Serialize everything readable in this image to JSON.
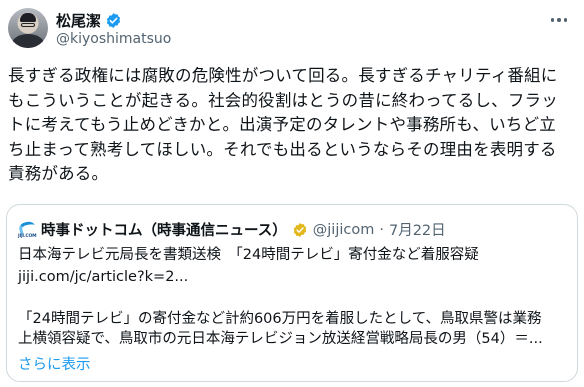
{
  "author": {
    "display_name": "松尾潔",
    "handle": "@kiyoshimatsuo",
    "verified_color": "#1d9bf0"
  },
  "tweet": {
    "text": "長すぎる政権には腐敗の危険性がついて回る。長すぎるチャリティ番組に\nもこういうことが起きる。社会的役割はとうの昔に終わってるし、フラッ\nトに考えてもう止めどきかと。出演予定のタレントや事務所も、いちど立\nち止まって熟考してほしい。それでも出るというならその理由を表明する\n責務がある。"
  },
  "quote": {
    "logo_label": "JIJI.COM",
    "name": "時事ドットコム（時事通信ニュース）",
    "verified_color": "#e2b719",
    "handle": "@jijicom",
    "separator": "·",
    "date": "7月22日",
    "headline": "日本海テレビ元局長を書類送検　「24時間テレビ」寄付金など着服容疑",
    "url": "jiji.com/jc/article?k=2...",
    "body": "「24時間テレビ」の寄付金など計約606万円を着服したとして、鳥取県警は業務\n上横領容疑で、鳥取市の元日本海テレビジョン放送経営戦略局長の男（54）＝...",
    "show_more": "さらに表示"
  },
  "colors": {
    "text": "#0f1419",
    "secondary": "#536471",
    "link": "#1d9bf0",
    "border": "#cfd9de"
  }
}
